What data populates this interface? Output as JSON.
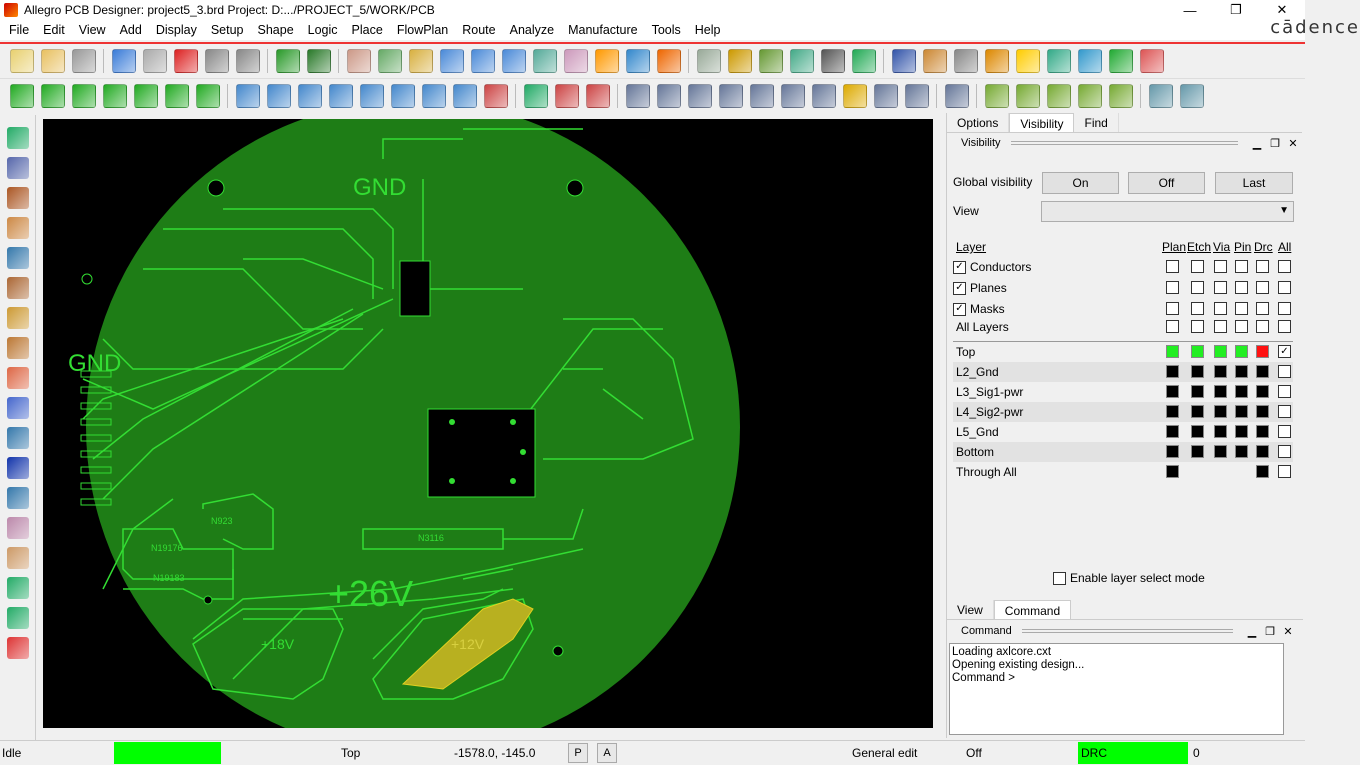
{
  "window": {
    "title": "Allegro PCB Designer: project5_3.brd  Project: D:.../PROJECT_5/WORK/PCB",
    "brand": "cādence",
    "minimize": "—",
    "maximize": "❐",
    "close": "✕"
  },
  "menu": [
    "File",
    "Edit",
    "View",
    "Add",
    "Display",
    "Setup",
    "Shape",
    "Logic",
    "Place",
    "FlowPlan",
    "Route",
    "Analyze",
    "Manufacture",
    "Tools",
    "Help"
  ],
  "board": {
    "labels": {
      "gnd_top": "GND",
      "gnd_left": "GND",
      "v26": "+26V",
      "v18": "+18V",
      "v12": "+12V",
      "net1": "N19176",
      "net2": "N19183",
      "net3": "N3116",
      "net4": "N923"
    }
  },
  "panel": {
    "tabs": [
      "Options",
      "Visibility",
      "Find"
    ],
    "active_tab": "Visibility",
    "visibility_title": "Visibility",
    "global_visibility_label": "Global visibility",
    "btn_on": "On",
    "btn_off": "Off",
    "btn_last": "Last",
    "view_label": "View",
    "view_value": "",
    "layer_col": "Layer",
    "columns": [
      "Plan",
      "Etch",
      "Via",
      "Pin",
      "Drc",
      "All"
    ],
    "groups": [
      {
        "label": "Conductors",
        "checked": true
      },
      {
        "label": "Planes",
        "checked": true
      },
      {
        "label": "Masks",
        "checked": true
      }
    ],
    "all_layers_label": "All Layers",
    "layers": [
      {
        "name": "Top",
        "colors": [
          "#22ee22",
          "#22ee22",
          "#22ee22",
          "#22ee22",
          "#ff1111"
        ],
        "all": true
      },
      {
        "name": "L2_Gnd",
        "colors": [
          "#000",
          "#000",
          "#000",
          "#000",
          "#000"
        ],
        "all": false
      },
      {
        "name": "L3_Sig1-pwr",
        "colors": [
          "#000",
          "#000",
          "#000",
          "#000",
          "#000"
        ],
        "all": false
      },
      {
        "name": "L4_Sig2-pwr",
        "colors": [
          "#000",
          "#000",
          "#000",
          "#000",
          "#000"
        ],
        "all": false
      },
      {
        "name": "L5_Gnd",
        "colors": [
          "#000",
          "#000",
          "#000",
          "#000",
          "#000"
        ],
        "all": false
      },
      {
        "name": "Bottom",
        "colors": [
          "#000",
          "#000",
          "#000",
          "#000",
          "#000"
        ],
        "all": false
      },
      {
        "name": "Through All",
        "colors": [
          "#000",
          null,
          null,
          null,
          "#000"
        ],
        "all": false
      }
    ],
    "enable_layer_select": "Enable layer select mode",
    "bottom_tabs": [
      "View",
      "Command"
    ],
    "command_title": "Command",
    "command_lines": [
      "Loading axlcore.cxt",
      "Opening existing design...",
      "Command >"
    ]
  },
  "status": {
    "state": "Idle",
    "layer": "Top",
    "coords": "-1578.0, -145.0",
    "p": "P",
    "a": "A",
    "mode": "General edit",
    "snap": "Off",
    "drc": "DRC",
    "drc_count": "0"
  },
  "colors": {
    "board": "#1e7d16",
    "trace": "#33dd33",
    "drc_ok": "#00ff00",
    "power_shape": "#b8b020"
  }
}
